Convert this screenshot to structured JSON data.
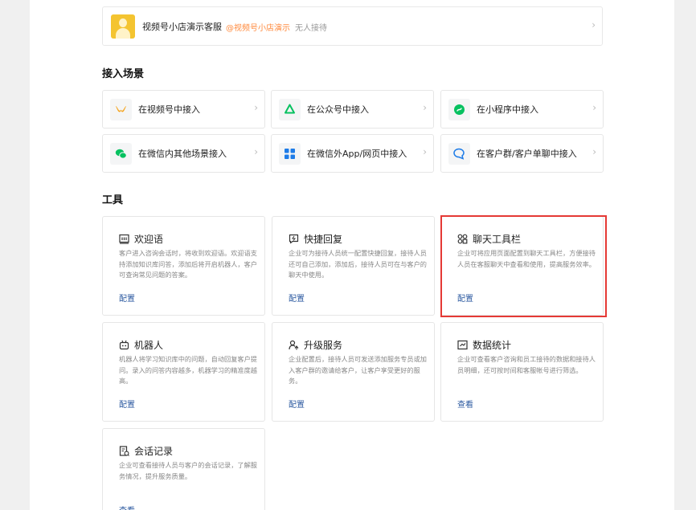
{
  "account": {
    "name": "视频号小店演示客服",
    "handle": "@视频号小店演示",
    "status": "无人接待"
  },
  "sections": {
    "scenes_title": "接入场景",
    "tools_title": "工具"
  },
  "scenes": [
    {
      "label": "在视频号中接入",
      "icon": "channels-icon",
      "color": "#f5a623"
    },
    {
      "label": "在公众号中接入",
      "icon": "official-account-icon",
      "color": "#07c160"
    },
    {
      "label": "在小程序中接入",
      "icon": "mini-program-icon",
      "color": "#07c160"
    },
    {
      "label": "在微信内其他场景接入",
      "icon": "wechat-icon",
      "color": "#07c160"
    },
    {
      "label": "在微信外App/网页中接入",
      "icon": "app-grid-icon",
      "color": "#1e7ce8"
    },
    {
      "label": "在客户群/客户单聊中接入",
      "icon": "chat-bubble-icon",
      "color": "#1e7ce8"
    }
  ],
  "tools": [
    {
      "title": "欢迎语",
      "icon": "welcome-icon",
      "desc": "客户进入咨询会话时，将收到欢迎语。欢迎语支持添加知识库问答，添加后将开启机器人，客户可查询常见问题的答案。",
      "link": "配置"
    },
    {
      "title": "快捷回复",
      "icon": "quick-reply-icon",
      "desc": "企业可为接待人员统一配置快捷回复，接待人员还可自己添加，添加后，接待人员可在与客户的聊天中使用。",
      "link": "配置"
    },
    {
      "title": "聊天工具栏",
      "icon": "toolbar-icon",
      "desc": "企业可将应用页面配置到聊天工具栏，方便接待人员在客服聊天中查看和使用，提高服务效率。",
      "link": "配置"
    },
    {
      "title": "机器人",
      "icon": "robot-icon",
      "desc": "机器人将学习知识库中的问题，自动回复客户提问。录入的问答内容越多，机器学习的精准度越高。",
      "link": "配置"
    },
    {
      "title": "升级服务",
      "icon": "upgrade-service-icon",
      "desc": "企业配置后，接待人员可发送添加服务专员或加入客户群的邀请给客户，让客户享受更好的服务。",
      "link": "配置"
    },
    {
      "title": "数据统计",
      "icon": "statistics-icon",
      "desc": "企业可查看客户咨询和员工接待的数据和接待人员明细，还可按时间和客服帐号进行筛选。",
      "link": "查看"
    },
    {
      "title": "会话记录",
      "icon": "chat-record-icon",
      "desc": "企业可查看接待人员与客户的会话记录，了解服务情况，提升服务质量。",
      "link": "查看"
    }
  ]
}
